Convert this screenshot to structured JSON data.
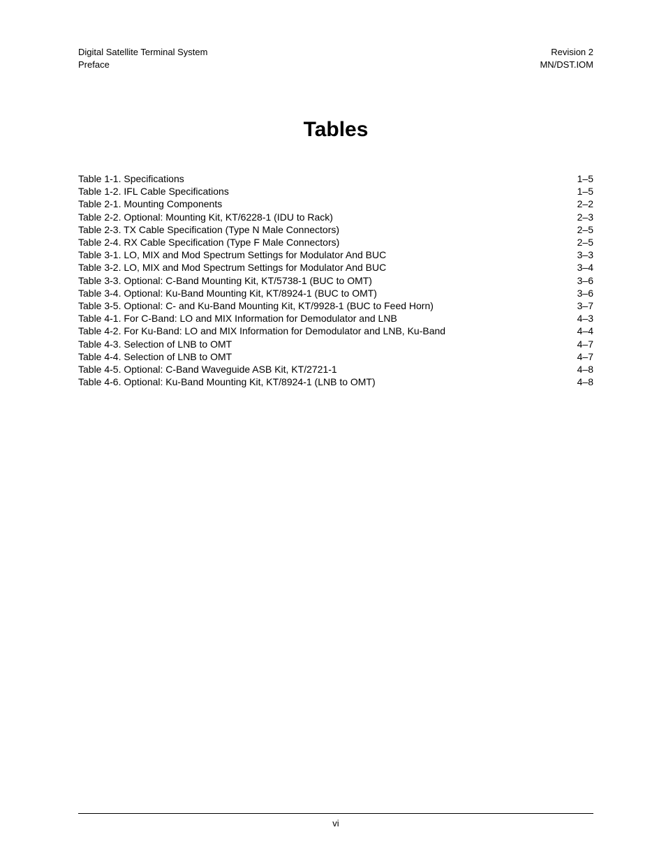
{
  "header": {
    "left_line1": "Digital Satellite Terminal System",
    "left_line2": "Preface",
    "right_line1": "Revision 2",
    "right_line2": "MN/DST.IOM"
  },
  "title": "Tables",
  "toc": [
    {
      "label": "Table 1-1. Specifications",
      "page": "1–5"
    },
    {
      "label": "Table 1-2. IFL Cable Specifications",
      "page": "1–5"
    },
    {
      "label": "Table 2-1. Mounting Components",
      "page": "2–2"
    },
    {
      "label": "Table 2-2. Optional: Mounting Kit, KT/6228-1 (IDU to Rack)",
      "page": "2–3"
    },
    {
      "label": "Table 2-3. TX Cable Specification (Type N Male Connectors)",
      "page": "2–5"
    },
    {
      "label": "Table 2-4. RX Cable Specification (Type F Male Connectors)",
      "page": "2–5"
    },
    {
      "label": "Table 3-1. LO, MIX and Mod Spectrum Settings for Modulator And BUC",
      "page": "3–3"
    },
    {
      "label": "Table 3-2. LO, MIX and Mod Spectrum Settings for Modulator And BUC",
      "page": "3–4"
    },
    {
      "label": "Table 3-3. Optional: C-Band Mounting Kit, KT/5738-1    (BUC to OMT)",
      "page": "3–6"
    },
    {
      "label": "Table 3-4. Optional: Ku-Band Mounting Kit, KT/8924-1  (BUC to OMT)",
      "page": "3–6"
    },
    {
      "label": "Table 3-5. Optional: C- and Ku-Band Mounting Kit, KT/9928-1 (BUC to Feed Horn) ",
      "page": "3–7"
    },
    {
      "label": "Table 4-1. For C-Band: LO and MIX Information for Demodulator and LNB",
      "page": "4–3"
    },
    {
      "label": "Table 4-2. For Ku-Band: LO and MIX Information for Demodulator and LNB, Ku-Band",
      "page": "4–4"
    },
    {
      "label": "Table 4-3. Selection of LNB to OMT",
      "page": "4–7"
    },
    {
      "label": "Table 4-4. Selection of LNB to OMT",
      "page": "4–7"
    },
    {
      "label": "Table 4-5. Optional: C-Band Waveguide ASB Kit, KT/2721-1",
      "page": "4–8"
    },
    {
      "label": "Table 4-6. Optional: Ku-Band Mounting Kit, KT/8924-1  (LNB to OMT)",
      "page": "4–8"
    }
  ],
  "footer": {
    "page_number": "vi"
  }
}
